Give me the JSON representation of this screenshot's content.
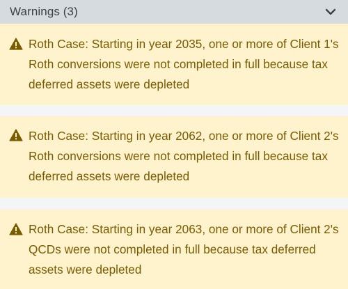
{
  "header": {
    "title": "Warnings (3)",
    "toggle_icon": "chevron-down-icon"
  },
  "warnings": [
    {
      "icon": "warning-triangle-icon",
      "text": "Roth Case: Starting in year 2035, one or more of Client 1's Roth conversions were not completed in full because tax deferred assets were depleted"
    },
    {
      "icon": "warning-triangle-icon",
      "text": "Roth Case: Starting in year 2062, one or more of Client 2's Roth conversions were not completed in full because tax deferred assets were depleted"
    },
    {
      "icon": "warning-triangle-icon",
      "text": "Roth Case: Starting in year 2063, one or more of Client 2's QCDs were not completed in full because tax deferred assets were depleted"
    }
  ],
  "colors": {
    "header_bg": "#d6dbe0",
    "warning_bg": "#fff3cd",
    "warning_text": "#7a5c00",
    "separator_bg": "#f4f5f7"
  }
}
